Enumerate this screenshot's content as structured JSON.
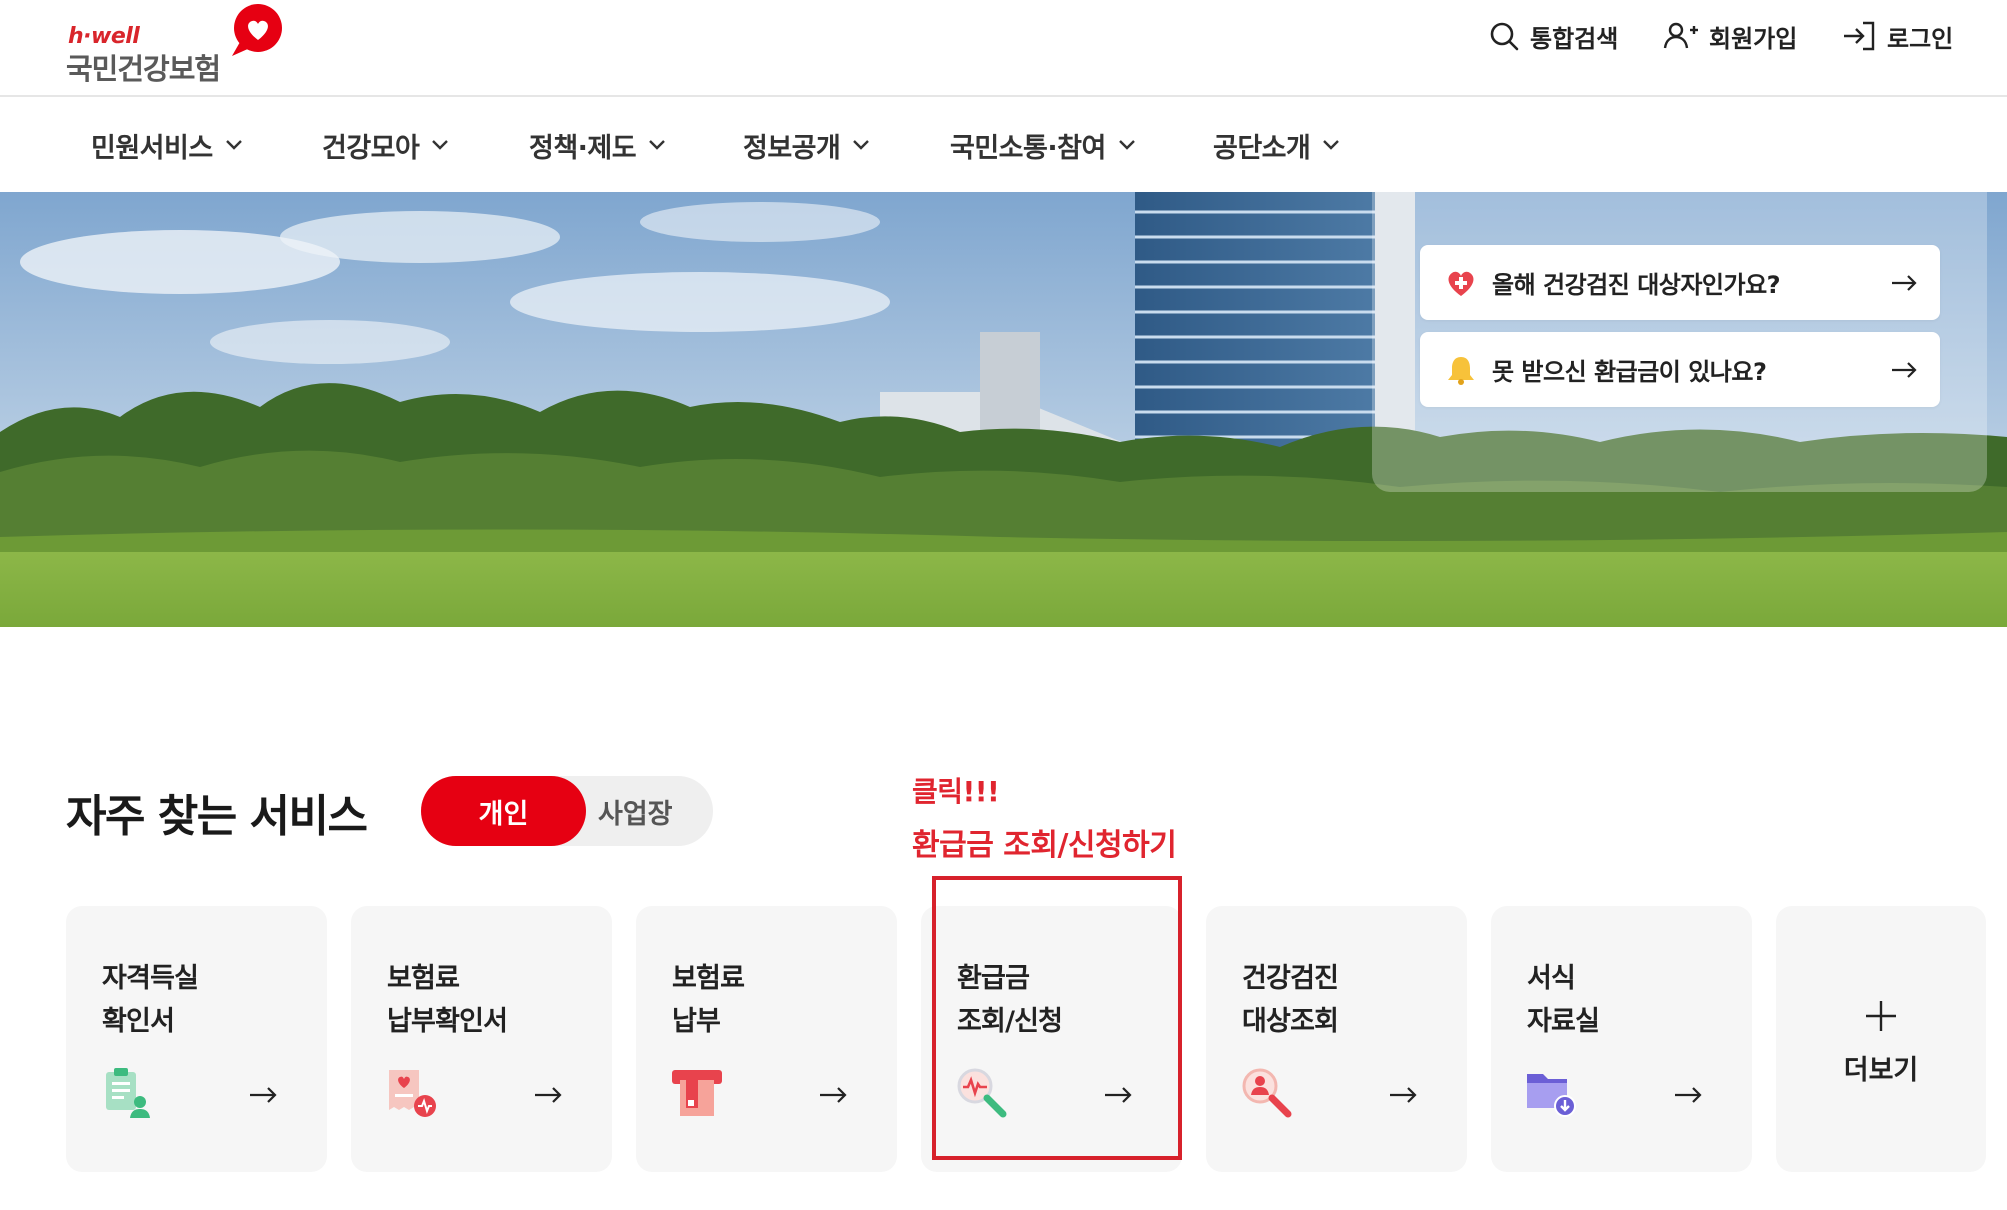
{
  "header": {
    "logo_sub": "h·well",
    "logo_main": "국민건강보험",
    "utils": {
      "search": "통합검색",
      "join": "회원가입",
      "login": "로그인"
    }
  },
  "gnb": [
    {
      "label": "민원서비스"
    },
    {
      "label": "건강모아"
    },
    {
      "label": "정책·제도"
    },
    {
      "label": "정보공개"
    },
    {
      "label": "국민소통·참여"
    },
    {
      "label": "공단소개"
    }
  ],
  "hero": {
    "quick_links": [
      {
        "label": "올해 건강검진 대상자인가요?",
        "icon": "heart-cross-icon"
      },
      {
        "label": "못 받으신 환급금이 있나요?",
        "icon": "bell-icon"
      }
    ]
  },
  "services": {
    "title": "자주 찾는 서비스",
    "toggle": {
      "active": "개인",
      "inactive": "사업장"
    },
    "annotation": {
      "line1": "클릭!!!",
      "line2": "환급금 조회/신청하기"
    },
    "cards": [
      {
        "line1": "자격득실",
        "line2": "확인서",
        "icon": "document-person-icon"
      },
      {
        "line1": "보험료",
        "line2": "납부확인서",
        "icon": "receipt-heart-icon"
      },
      {
        "line1": "보험료",
        "line2": "납부",
        "icon": "payment-terminal-icon"
      },
      {
        "line1": "환급금",
        "line2": "조회/신청",
        "icon": "magnifier-pulse-icon"
      },
      {
        "line1": "건강검진",
        "line2": "대상조회",
        "icon": "magnifier-person-icon"
      },
      {
        "line1": "서식",
        "line2": "자료실",
        "icon": "folder-download-icon"
      }
    ],
    "more": "더보기"
  },
  "colors": {
    "brand_red": "#e60012",
    "annotation_red": "#e0252f",
    "card_bg": "#f6f6f6"
  }
}
